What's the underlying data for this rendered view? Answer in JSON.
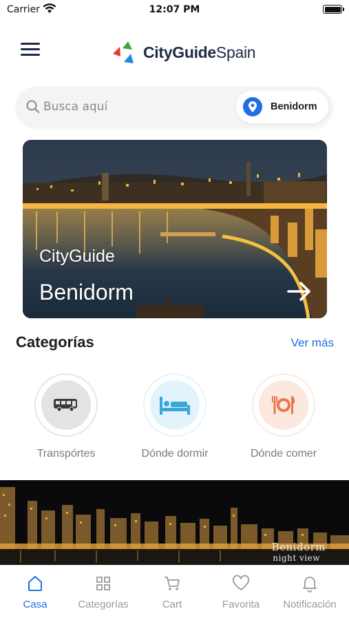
{
  "status_bar": {
    "carrier": "Carrier",
    "time": "12:07 PM"
  },
  "header": {
    "logo_bold": "CityGuide",
    "logo_regular": "Spain",
    "menu_icon": "hamburger-menu-icon"
  },
  "search": {
    "placeholder": "Busca aquí",
    "value": "",
    "location_label": "Benidorm",
    "location_icon": "map-pin-icon"
  },
  "hero": {
    "kicker": "CityGuide",
    "title": "Benidorm",
    "arrow_icon": "arrow-right-icon"
  },
  "categories": {
    "title": "Categorías",
    "more_label": "Ver más",
    "items": [
      {
        "label": "Transpórtes",
        "icon": "bus-icon"
      },
      {
        "label": "Dónde dormir",
        "icon": "bed-icon"
      },
      {
        "label": "Dónde comer",
        "icon": "plate-cutlery-icon"
      }
    ]
  },
  "banner": {
    "title": "Benidorm",
    "subtitle": "night view"
  },
  "tabbar": {
    "items": [
      {
        "label": "Casa",
        "icon": "home-icon",
        "active": true
      },
      {
        "label": "Categorías",
        "icon": "grid-icon",
        "active": false
      },
      {
        "label": "Cart",
        "icon": "cart-icon",
        "active": false
      },
      {
        "label": "Favorita",
        "icon": "heart-icon",
        "active": false
      },
      {
        "label": "Notificación",
        "icon": "bell-icon",
        "active": false
      }
    ]
  },
  "colors": {
    "accent": "#1f6fe5",
    "text_dark": "#1d1d1d",
    "text_muted": "#7a7a7a"
  }
}
